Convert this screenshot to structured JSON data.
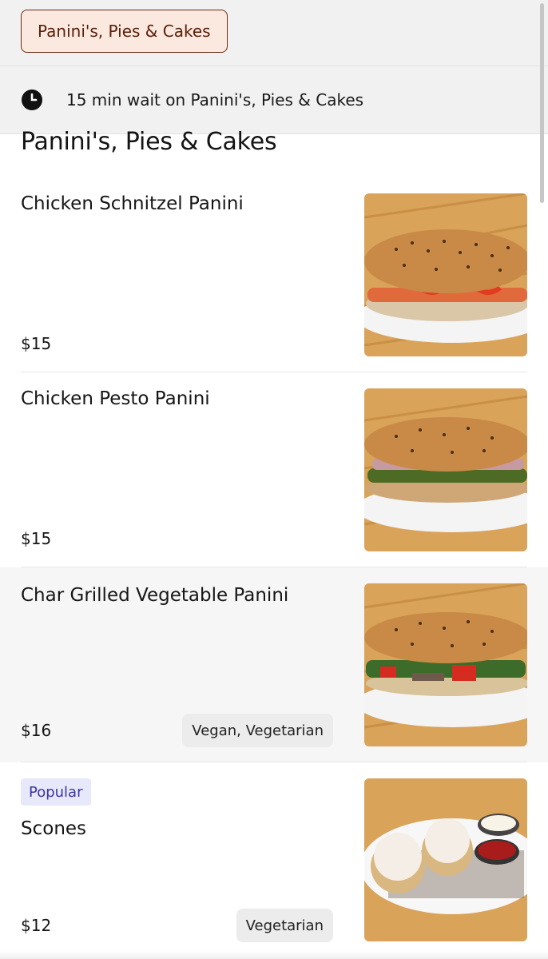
{
  "category_tabs": {
    "active_label": "Panini's, Pies & Cakes"
  },
  "wait_banner": {
    "icon": "clock-icon",
    "text": "15 min wait on Panini's, Pies & Cakes"
  },
  "section": {
    "title": "Panini's, Pies & Cakes"
  },
  "items": [
    {
      "name": "Chicken Schnitzel Panini",
      "price": "$15",
      "tags": "",
      "badge": "",
      "image": "schnitzel-panini-photo"
    },
    {
      "name": "Chicken Pesto Panini",
      "price": "$15",
      "tags": "",
      "badge": "",
      "image": "pesto-panini-photo"
    },
    {
      "name": "Char Grilled Vegetable Panini",
      "price": "$16",
      "tags": "Vegan, Vegetarian",
      "badge": "",
      "image": "vegetable-panini-photo"
    },
    {
      "name": "Scones",
      "price": "$12",
      "tags": "Vegetarian",
      "badge": "Popular",
      "image": "scones-photo"
    }
  ],
  "colors": {
    "pill_bg": "#fbe9e0",
    "pill_border": "#6b2a12",
    "popular_bg": "#e8e8fb",
    "popular_text": "#3b34a8",
    "highlight_row": "#f6f6f6"
  }
}
